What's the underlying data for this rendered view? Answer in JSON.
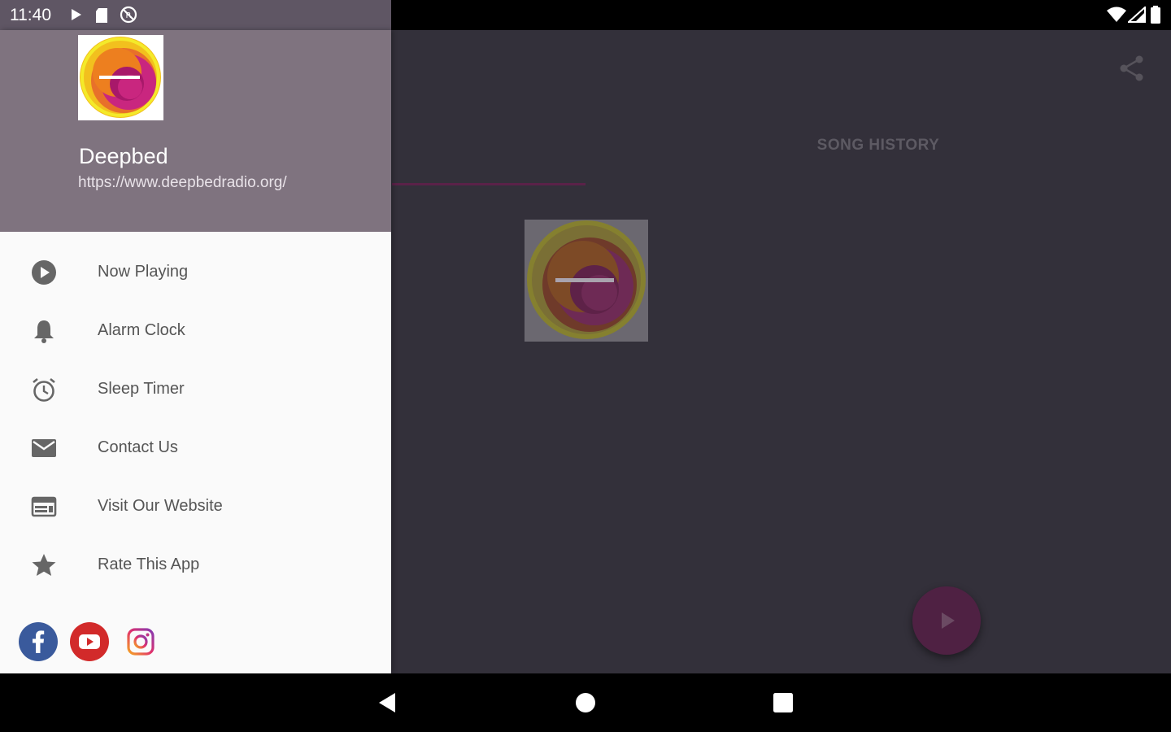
{
  "status_bar": {
    "time": "11:40",
    "left_icons": [
      "play-icon",
      "sd-card-icon",
      "sync-disabled-icon"
    ],
    "right_icons": [
      "wifi-icon",
      "cell-signal-icon",
      "battery-icon"
    ]
  },
  "drawer": {
    "header": {
      "logo_icon": "deepbed-logo",
      "title": "Deepbed",
      "subtitle": "https://www.deepbedradio.org/"
    },
    "items": [
      {
        "label": "Now Playing",
        "icon": "play-circle-icon"
      },
      {
        "label": "Alarm Clock",
        "icon": "bell-icon"
      },
      {
        "label": "Sleep Timer",
        "icon": "alarm-clock-icon"
      },
      {
        "label": "Contact Us",
        "icon": "mail-icon"
      },
      {
        "label": "Visit Our Website",
        "icon": "web-icon"
      },
      {
        "label": "Rate This App",
        "icon": "star-icon"
      }
    ],
    "social": [
      "facebook-icon",
      "youtube-icon",
      "instagram-icon"
    ]
  },
  "main": {
    "tabs": [
      {
        "label": ""
      },
      {
        "label": "SONG HISTORY"
      }
    ],
    "share_icon": "share-icon",
    "fab_icon": "play-icon"
  },
  "nav_bar": {
    "buttons": [
      "back-icon",
      "home-icon",
      "recents-icon"
    ]
  },
  "colors": {
    "drawer_header": "#7f737f",
    "main_background": "#33303a",
    "accent": "#5a2248",
    "fab": "#4f2143"
  }
}
